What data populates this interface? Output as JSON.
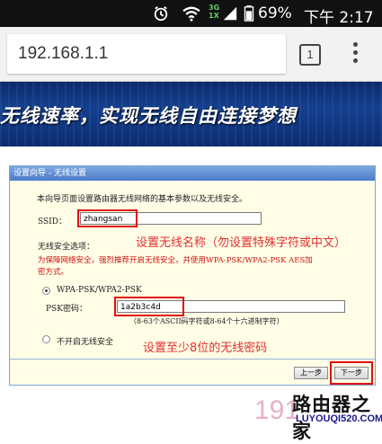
{
  "status_bar": {
    "battery_percent": "69%",
    "time": "下午 2:17",
    "network_label_top": "3G",
    "network_label_bottom": "1X"
  },
  "browser": {
    "url": "192.168.1.1",
    "tab_count": "1"
  },
  "banner": {
    "text": "无线速率，实现无线自由连接梦想"
  },
  "wizard": {
    "title": "设置向导 - 无线设置",
    "intro": "本向导页面设置路由器无线网络的基本参数以及无线安全。",
    "ssid_label": "SSID：",
    "ssid_value": "zhangsan",
    "ssid_note": "设置无线名称（勿设置特殊字符或中文）",
    "security_options_label": "无线安全选项：",
    "security_warning_line1": "为保障网络安全，强烈推荐开启无线安全，并使用WPA-PSK/WPA2-PSK AES加",
    "security_warning_line2": "密方式。",
    "option_wpa_label": "WPA-PSK/WPA2-PSK",
    "psk_label": "PSK密码：",
    "psk_value": "1a2b3c4d",
    "psk_hint": "（8-63个ASCII码字符或8-64个十六进制字符）",
    "option_none_label": "不开启无线安全",
    "psk_note": "设置至少8位的无线密码",
    "prev_button": "上一步",
    "next_button": "下一步"
  },
  "watermark": {
    "brand": "路由器之家",
    "domain": "LUYOUQI520.COM",
    "prefix": "191"
  },
  "colors": {
    "annotation_red": "#e01010",
    "panel_bg": "#fffde6",
    "title_bar": "#4a7bc8"
  }
}
